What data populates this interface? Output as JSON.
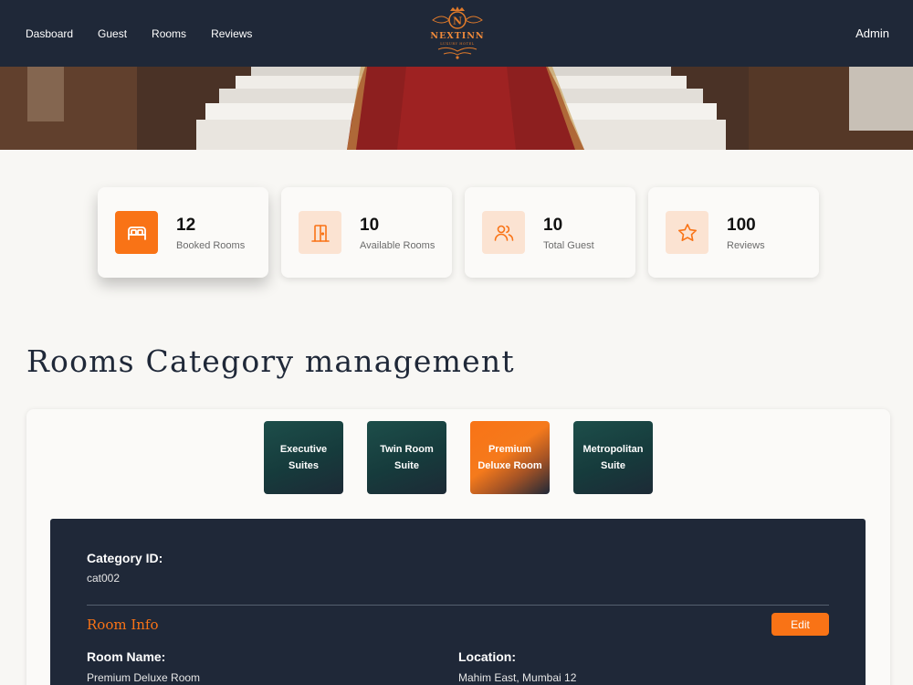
{
  "nav": {
    "items": [
      {
        "label": "Dasboard"
      },
      {
        "label": "Guest"
      },
      {
        "label": "Rooms"
      },
      {
        "label": "Reviews"
      }
    ],
    "user": "Admin"
  },
  "logo": {
    "name": "NEXTINN",
    "tagline": "LUXURY HOTEL",
    "monogram": "N"
  },
  "stats": [
    {
      "value": "12",
      "label": "Booked Rooms",
      "icon": "bed-icon"
    },
    {
      "value": "10",
      "label": "Available Rooms",
      "icon": "door-icon"
    },
    {
      "value": "10",
      "label": "Total Guest",
      "icon": "users-icon"
    },
    {
      "value": "100",
      "label": "Reviews",
      "icon": "star-icon"
    }
  ],
  "page_title": "Rooms Category management",
  "categories": [
    {
      "label": "Executive Suites"
    },
    {
      "label": "Twin Room Suite"
    },
    {
      "label": "Premium Deluxe Room"
    },
    {
      "label": "Metropolitan Suite"
    }
  ],
  "selected_category": "Premium Deluxe Room",
  "details": {
    "category_id_label": "Category ID:",
    "category_id": "cat002",
    "section_title": "Room Info",
    "edit_label": "Edit",
    "room_name_label": "Room Name:",
    "room_name": "Premium Deluxe Room",
    "location_label": "Location:",
    "location": "Mahim East, Mumbai 12"
  },
  "colors": {
    "accent": "#f97316",
    "navy": "#1f2838",
    "teal": "#1d4e4a",
    "icon_bg": "#fbe3d2"
  }
}
